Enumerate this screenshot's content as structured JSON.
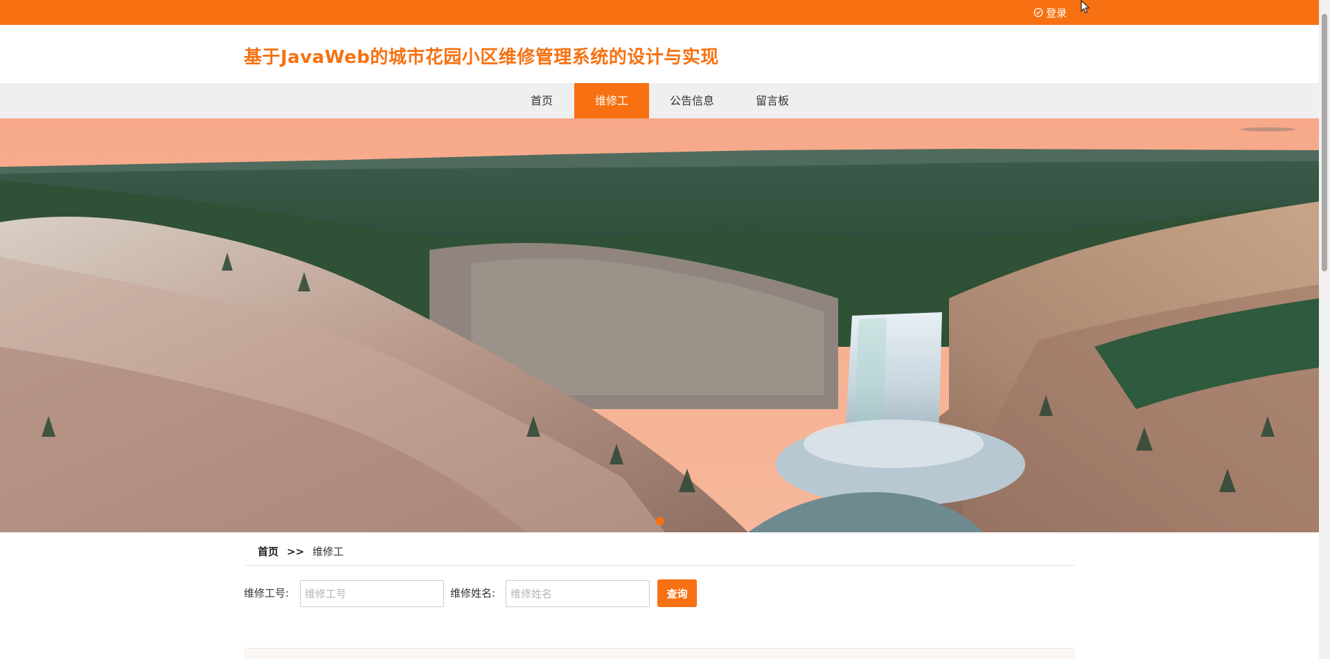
{
  "topbar": {
    "login_label": "登录",
    "login_icon": "check-circle-icon",
    "color": "#f77112"
  },
  "header": {
    "site_title": "基于JavaWeb的城市花园小区维修管理系统的设计与实现"
  },
  "nav": {
    "items": [
      {
        "label": "首页",
        "active": false
      },
      {
        "label": "维修工",
        "active": true
      },
      {
        "label": "公告信息",
        "active": false
      },
      {
        "label": "留言板",
        "active": false
      }
    ]
  },
  "banner": {
    "image": "waterfall-canyon-landscape",
    "active_slide": 1,
    "slide_count": 1
  },
  "breadcrumb": {
    "home": "首页",
    "separator": ">>",
    "current": "维修工"
  },
  "search": {
    "worker_no_label": "维修工号:",
    "worker_no_value": "",
    "worker_no_placeholder": "维修工号",
    "worker_name_label": "维修姓名:",
    "worker_name_value": "",
    "worker_name_placeholder": "维修姓名",
    "submit_label": "查询"
  },
  "colors": {
    "accent": "#f77112",
    "nav_background": "#efefef",
    "text": "#333333"
  }
}
